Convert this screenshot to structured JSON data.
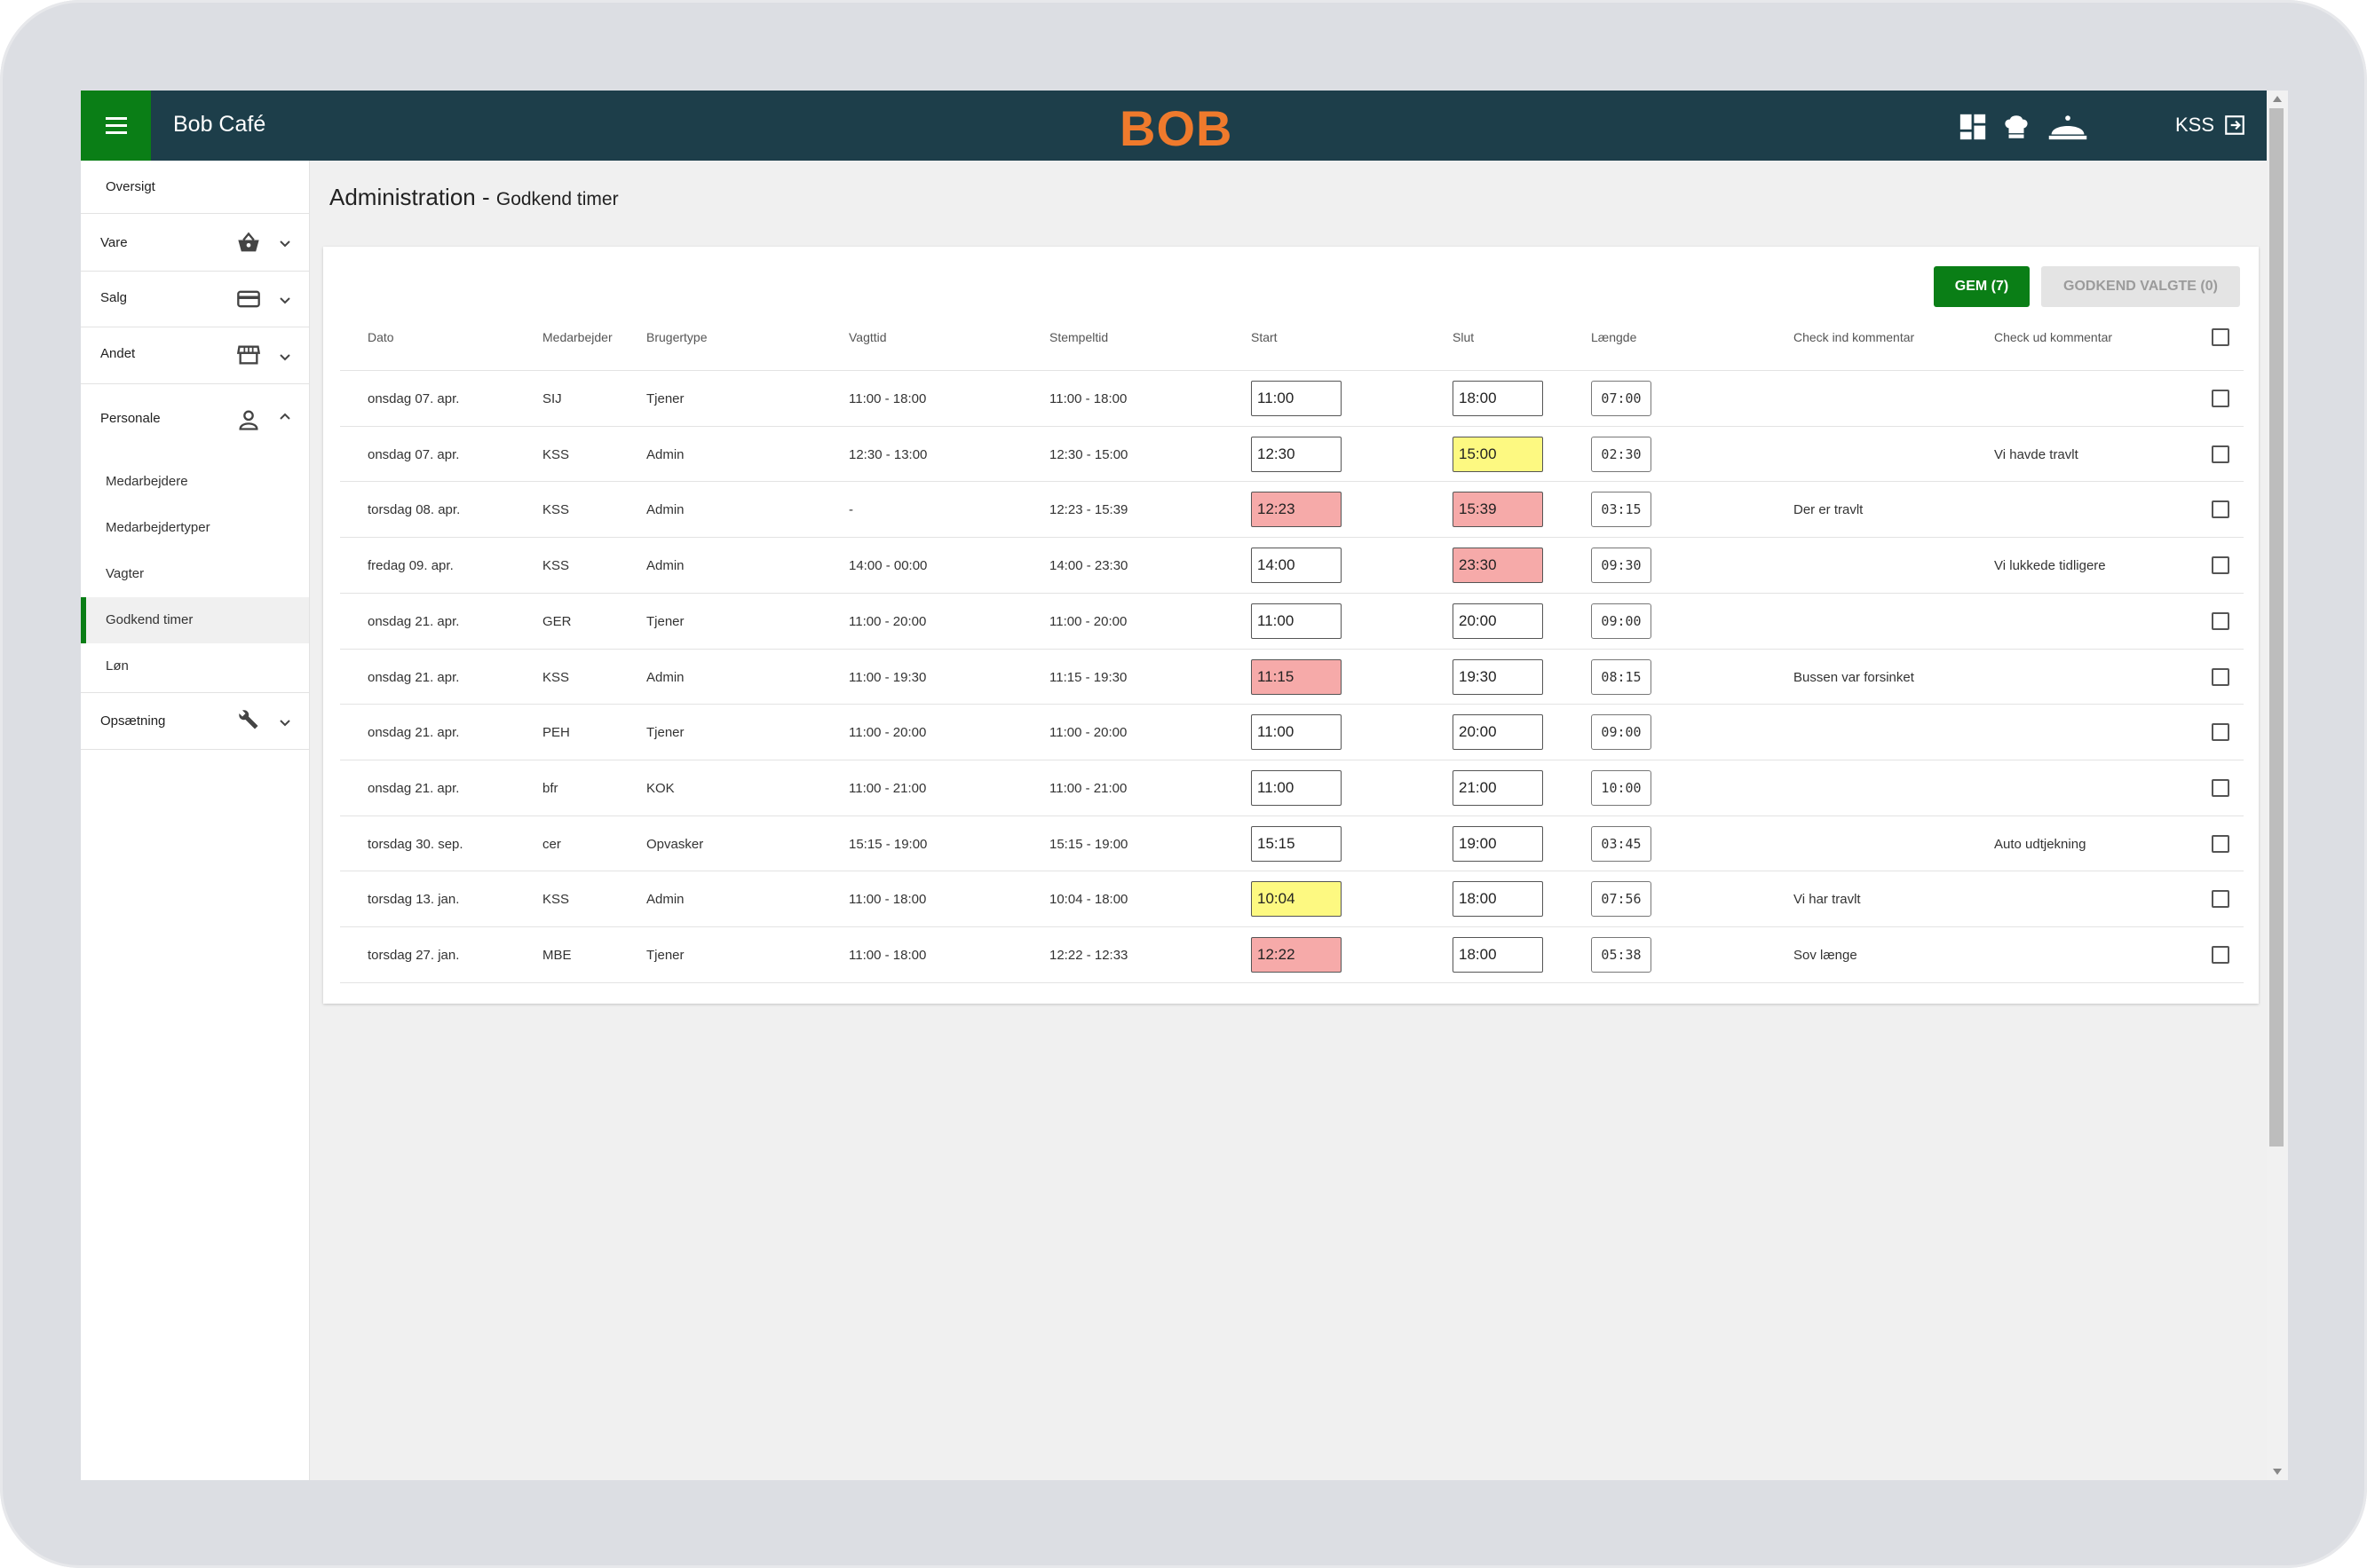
{
  "header": {
    "app_name": "Bob Café",
    "logo": "BOB",
    "user": "KSS",
    "icons": [
      "dashboard-icon",
      "chef-hat-icon",
      "cloche-icon",
      "logout-icon"
    ],
    "colors": {
      "bar": "#1d3e4a",
      "accent": "#0a7e16",
      "logo": "#ef7a2c"
    }
  },
  "sidebar": {
    "items": [
      {
        "label": "Oversigt"
      },
      {
        "label": "Vare",
        "icon": "basket-icon"
      },
      {
        "label": "Salg",
        "icon": "credit-card-icon"
      },
      {
        "label": "Andet",
        "icon": "store-icon"
      },
      {
        "label": "Personale",
        "icon": "person-icon",
        "expanded": true,
        "children": [
          "Medarbejdere",
          "Medarbejdertyper",
          "Vagter",
          "Godkend timer",
          "Løn"
        ]
      },
      {
        "label": "Opsætning",
        "icon": "wrench-icon"
      }
    ],
    "active_child": "Godkend timer"
  },
  "page": {
    "title": "Administration -",
    "subtitle": "Godkend timer"
  },
  "actions": {
    "save": "GEM (7)",
    "approve": "GODKEND VALGTE (0)"
  },
  "table": {
    "headers": {
      "dato": "Dato",
      "medarbejder": "Medarbejder",
      "brugertype": "Brugertype",
      "vagttid": "Vagttid",
      "stempeltid": "Stempeltid",
      "start": "Start",
      "slut": "Slut",
      "laengde": "Længde",
      "checkin": "Check ind kommentar",
      "checkout": "Check ud kommentar"
    },
    "rows": [
      {
        "dato": "onsdag 07. apr.",
        "medarbejder": "SIJ",
        "brugertype": "Tjener",
        "vagttid": "11:00 - 18:00",
        "stempeltid": "11:00 - 18:00",
        "start": "11:00",
        "start_state": "normal",
        "slut": "18:00",
        "slut_state": "normal",
        "laengde": "07:00",
        "checkin": "",
        "checkout": ""
      },
      {
        "dato": "onsdag 07. apr.",
        "medarbejder": "KSS",
        "brugertype": "Admin",
        "vagttid": "12:30 - 13:00",
        "stempeltid": "12:30 - 15:00",
        "start": "12:30",
        "start_state": "normal",
        "slut": "15:00",
        "slut_state": "yellow",
        "laengde": "02:30",
        "checkin": "",
        "checkout": "Vi havde travlt"
      },
      {
        "dato": "torsdag 08. apr.",
        "medarbejder": "KSS",
        "brugertype": "Admin",
        "vagttid": "-",
        "stempeltid": "12:23 - 15:39",
        "start": "12:23",
        "start_state": "red",
        "slut": "15:39",
        "slut_state": "red",
        "laengde": "03:15",
        "checkin": "Der er travlt",
        "checkout": ""
      },
      {
        "dato": "fredag 09. apr.",
        "medarbejder": "KSS",
        "brugertype": "Admin",
        "vagttid": "14:00 - 00:00",
        "stempeltid": "14:00 - 23:30",
        "start": "14:00",
        "start_state": "normal",
        "slut": "23:30",
        "slut_state": "red",
        "laengde": "09:30",
        "checkin": "",
        "checkout": "Vi lukkede tidligere"
      },
      {
        "dato": "onsdag 21. apr.",
        "medarbejder": "GER",
        "brugertype": "Tjener",
        "vagttid": "11:00 - 20:00",
        "stempeltid": "11:00 - 20:00",
        "start": "11:00",
        "start_state": "normal",
        "slut": "20:00",
        "slut_state": "normal",
        "laengde": "09:00",
        "checkin": "",
        "checkout": ""
      },
      {
        "dato": "onsdag 21. apr.",
        "medarbejder": "KSS",
        "brugertype": "Admin",
        "vagttid": "11:00 - 19:30",
        "stempeltid": "11:15 - 19:30",
        "start": "11:15",
        "start_state": "red",
        "slut": "19:30",
        "slut_state": "normal",
        "laengde": "08:15",
        "checkin": "Bussen var forsinket",
        "checkout": ""
      },
      {
        "dato": "onsdag 21. apr.",
        "medarbejder": "PEH",
        "brugertype": "Tjener",
        "vagttid": "11:00 - 20:00",
        "stempeltid": "11:00 - 20:00",
        "start": "11:00",
        "start_state": "normal",
        "slut": "20:00",
        "slut_state": "normal",
        "laengde": "09:00",
        "checkin": "",
        "checkout": ""
      },
      {
        "dato": "onsdag 21. apr.",
        "medarbejder": "bfr",
        "brugertype": "KOK",
        "vagttid": "11:00 - 21:00",
        "stempeltid": "11:00 - 21:00",
        "start": "11:00",
        "start_state": "normal",
        "slut": "21:00",
        "slut_state": "normal",
        "laengde": "10:00",
        "checkin": "",
        "checkout": ""
      },
      {
        "dato": "torsdag 30. sep.",
        "medarbejder": "cer",
        "brugertype": "Opvasker",
        "vagttid": "15:15 - 19:00",
        "stempeltid": "15:15 - 19:00",
        "start": "15:15",
        "start_state": "normal",
        "slut": "19:00",
        "slut_state": "normal",
        "laengde": "03:45",
        "checkin": "",
        "checkout": "Auto udtjekning"
      },
      {
        "dato": "torsdag 13. jan.",
        "medarbejder": "KSS",
        "brugertype": "Admin",
        "vagttid": "11:00 - 18:00",
        "stempeltid": "10:04 - 18:00",
        "start": "10:04",
        "start_state": "yellow",
        "slut": "18:00",
        "slut_state": "normal",
        "laengde": "07:56",
        "checkin": "Vi har travlt",
        "checkout": ""
      },
      {
        "dato": "torsdag 27. jan.",
        "medarbejder": "MBE",
        "brugertype": "Tjener",
        "vagttid": "11:00 - 18:00",
        "stempeltid": "12:22 - 12:33",
        "start": "12:22",
        "start_state": "red",
        "slut": "18:00",
        "slut_state": "normal",
        "laengde": "05:38",
        "checkin": "Sov længe",
        "checkout": ""
      }
    ]
  }
}
